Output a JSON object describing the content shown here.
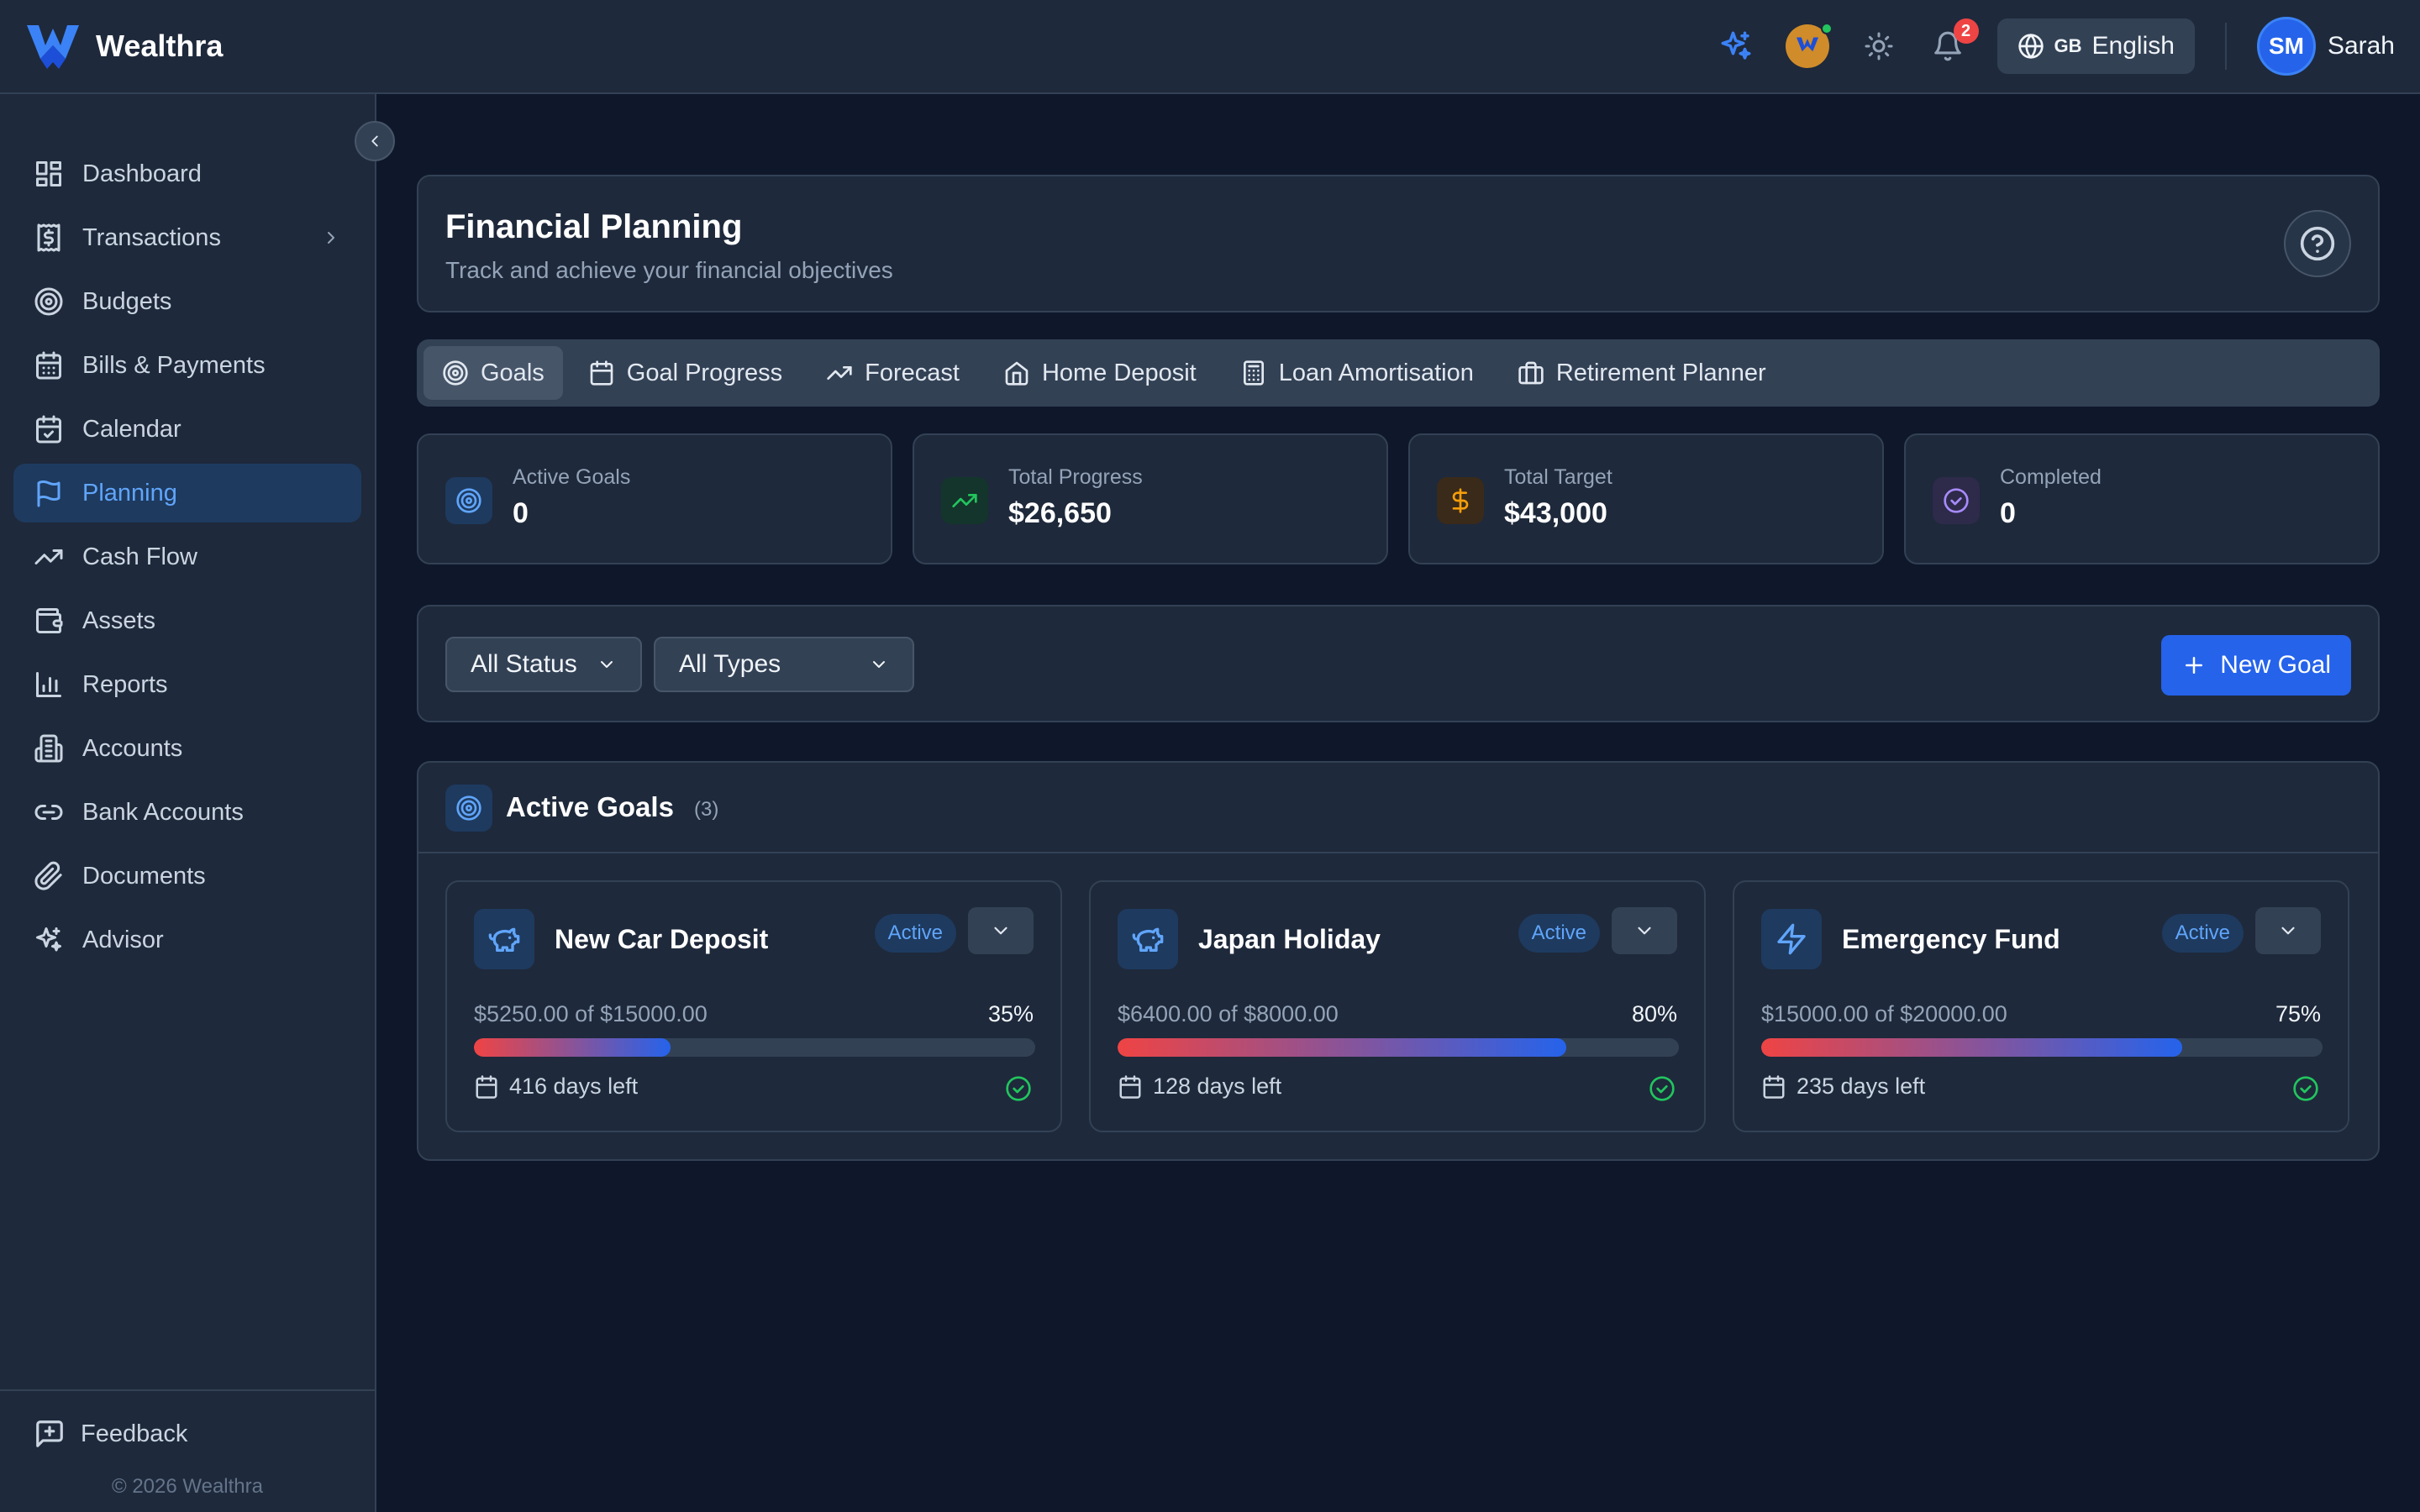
{
  "app": {
    "name": "Wealthra"
  },
  "header": {
    "language_flag": "GB",
    "language": "English",
    "notifications_count": "2",
    "user_initials": "SM",
    "user_name": "Sarah"
  },
  "sidebar": {
    "items": [
      {
        "label": "Dashboard",
        "icon": "dashboard-icon"
      },
      {
        "label": "Transactions",
        "icon": "receipt-icon"
      },
      {
        "label": "Budgets",
        "icon": "target-icon"
      },
      {
        "label": "Bills & Payments",
        "icon": "calendar-icon"
      },
      {
        "label": "Calendar",
        "icon": "calendar-check-icon"
      },
      {
        "label": "Planning",
        "icon": "flag-icon",
        "active": true
      },
      {
        "label": "Cash Flow",
        "icon": "trending-up-icon"
      },
      {
        "label": "Assets",
        "icon": "wallet-icon"
      },
      {
        "label": "Reports",
        "icon": "bar-chart-icon"
      },
      {
        "label": "Accounts",
        "icon": "building-icon"
      },
      {
        "label": "Bank Accounts",
        "icon": "link-icon"
      },
      {
        "label": "Documents",
        "icon": "paperclip-icon"
      },
      {
        "label": "Advisor",
        "icon": "sparkles-icon"
      }
    ],
    "feedback": "Feedback",
    "copyright": "© 2026 Wealthra"
  },
  "page": {
    "title": "Financial Planning",
    "subtitle": "Track and achieve your financial objectives"
  },
  "tabs": [
    {
      "label": "Goals",
      "icon": "target-icon",
      "active": true
    },
    {
      "label": "Goal Progress",
      "icon": "calendar-icon"
    },
    {
      "label": "Forecast",
      "icon": "trending-up-icon"
    },
    {
      "label": "Home Deposit",
      "icon": "home-icon"
    },
    {
      "label": "Loan Amortisation",
      "icon": "calculator-icon"
    },
    {
      "label": "Retirement Planner",
      "icon": "briefcase-icon"
    }
  ],
  "stats": [
    {
      "label": "Active Goals",
      "value": "0",
      "color": "#60a5fa"
    },
    {
      "label": "Total Progress",
      "value": "$26,650",
      "color": "#22c55e"
    },
    {
      "label": "Total Target",
      "value": "$43,000",
      "color": "#f59e0b"
    },
    {
      "label": "Completed",
      "value": "0",
      "color": "#a78bfa"
    }
  ],
  "filters": {
    "status": "All Status",
    "type": "All Types",
    "new_goal": "New Goal"
  },
  "goals_section": {
    "title": "Active Goals",
    "count": "(3)"
  },
  "goals": [
    {
      "name": "New Car Deposit",
      "status": "Active",
      "amount": "$5250.00 of $15000.00",
      "percent": "35%",
      "progress": 0.35,
      "days": "416 days left",
      "icon": "piggy-bank-icon"
    },
    {
      "name": "Japan Holiday",
      "status": "Active",
      "amount": "$6400.00 of $8000.00",
      "percent": "80%",
      "progress": 0.8,
      "days": "128 days left",
      "icon": "piggy-bank-icon"
    },
    {
      "name": "Emergency Fund",
      "status": "Active",
      "amount": "$15000.00 of $20000.00",
      "percent": "75%",
      "progress": 0.75,
      "days": "235 days left",
      "icon": "zap-icon"
    }
  ],
  "colors": {
    "accent": "#2563eb",
    "accent_light": "#60a5fa",
    "success": "#22c55e",
    "bar_low": "#ef4444",
    "bar_high": "#2563eb"
  }
}
